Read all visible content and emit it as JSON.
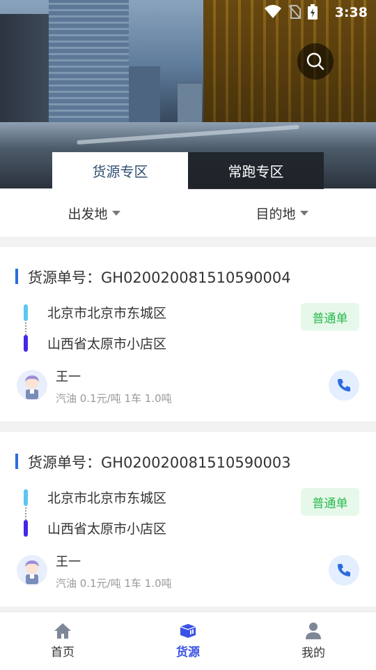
{
  "status_bar": {
    "time": "3:38",
    "icons": [
      "wifi-icon",
      "no-sim-icon",
      "battery-charging-icon"
    ]
  },
  "header": {
    "search_icon": "search-icon"
  },
  "tabs": [
    {
      "label": "货源专区",
      "active": true
    },
    {
      "label": "常跑专区",
      "active": false
    }
  ],
  "filters": [
    {
      "label": "出发地"
    },
    {
      "label": "目的地"
    }
  ],
  "cards": [
    {
      "order_label": "货源单号：GH020020081510590004",
      "from": "北京市北京市东城区",
      "to": "山西省太原市小店区",
      "badge": "普通单",
      "name": "王一",
      "meta": "汽油 0.1元/吨 1车 1.0吨"
    },
    {
      "order_label": "货源单号：GH020020081510590003",
      "from": "北京市北京市东城区",
      "to": "山西省太原市小店区",
      "badge": "普通单",
      "name": "王一",
      "meta": "汽油 0.1元/吨 1车 1.0吨"
    }
  ],
  "bottom_nav": [
    {
      "label": "首页",
      "icon": "home-icon",
      "active": false
    },
    {
      "label": "货源",
      "icon": "cargo-icon",
      "active": true
    },
    {
      "label": "我的",
      "icon": "user-icon",
      "active": false
    }
  ],
  "colors": {
    "accent": "#3a52e6",
    "badge_green": "#27b94c",
    "title_bar": "#2d6cdf"
  }
}
